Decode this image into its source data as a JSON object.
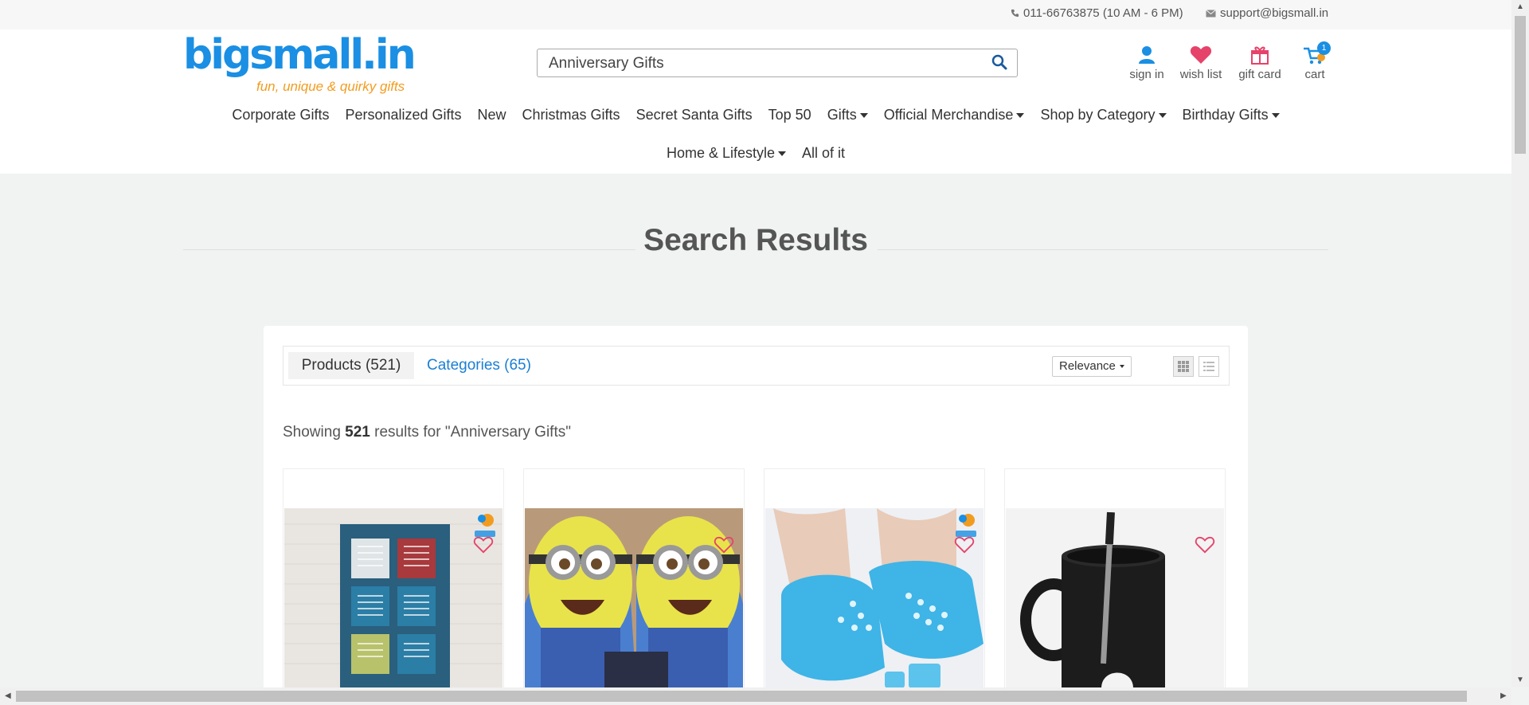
{
  "topbar": {
    "phone": "011-66763875 (10 AM - 6 PM)",
    "email": "support@bigsmall.in"
  },
  "header": {
    "logo_text": "bigsmall.in",
    "logo_tagline": "fun, unique & quirky gifts",
    "search_value": "Anniversary Gifts",
    "icons": [
      {
        "label": "sign in",
        "icon": "user-icon"
      },
      {
        "label": "wish list",
        "icon": "heart-icon"
      },
      {
        "label": "gift card",
        "icon": "gift-icon"
      },
      {
        "label": "cart",
        "icon": "cart-icon",
        "badge": "1"
      }
    ]
  },
  "nav": {
    "row1": [
      "Corporate Gifts",
      "Personalized Gifts",
      "New",
      "Christmas Gifts",
      "Secret Santa Gifts",
      "Top 50",
      "Gifts",
      "Official Merchandise",
      "Shop by Category",
      "Birthday Gifts"
    ],
    "row2": [
      "Home & Lifestyle",
      "All of it"
    ]
  },
  "page_title": "Search Results",
  "results": {
    "tab_products": "Products (521)",
    "tab_categories": "Categories (65)",
    "sort_label": "Relevance",
    "showing_prefix": "Showing",
    "count": "521",
    "showing_suffix": "results for \"Anniversary Gifts\""
  },
  "products": [
    {
      "name": "product-window-shutters-decor",
      "branded": true
    },
    {
      "name": "product-minion-slippers",
      "branded": false
    },
    {
      "name": "product-blue-spa-socks",
      "branded": true
    },
    {
      "name": "product-golf-mug",
      "branded": false
    }
  ],
  "colors": {
    "brand_blue": "#1a8fe3",
    "brand_orange": "#f29c1f",
    "heart_pink": "#e6436a",
    "link_blue": "#1a7fd4"
  }
}
